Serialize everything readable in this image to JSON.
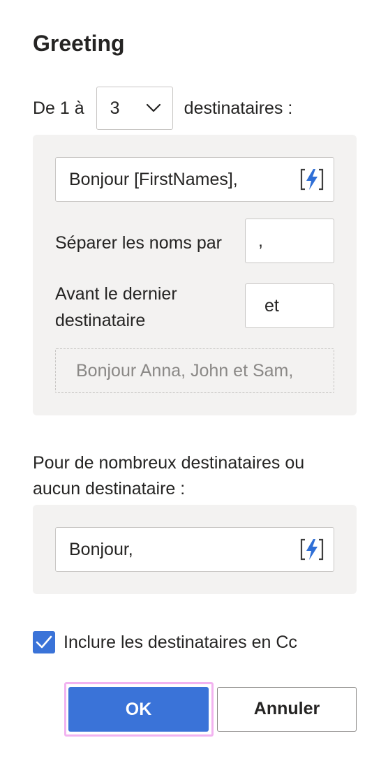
{
  "dialog": {
    "title": "Greeting"
  },
  "range": {
    "prefix": "De 1 à",
    "count_value": "3",
    "suffix": "destinataires :"
  },
  "named_panel": {
    "greeting_value": "Bonjour [FirstNames],",
    "separator_label": "Séparer les noms par",
    "separator_value": ",",
    "last_label_line1": "Avant le dernier",
    "last_label_line2": "destinataire",
    "last_value": "et",
    "preview_text": "Bonjour Anna, John et Sam,"
  },
  "fallback": {
    "label_line1": "Pour de nombreux destinataires ou",
    "label_line2": "aucun destinataire :",
    "greeting_value": "Bonjour,"
  },
  "cc": {
    "label": "Inclure les destinataires en Cc",
    "checked": true
  },
  "buttons": {
    "ok_label": "OK",
    "cancel_label": "Annuler"
  },
  "colors": {
    "accent": "#3a73d8",
    "panel_bg": "#f3f2f1",
    "focus_ring": "#f2b3f0",
    "border": "#c8c6c4",
    "placeholder_text": "#8a8886"
  },
  "icons": {
    "dropdown": "chevron-down-icon",
    "insert_field": "lightning-bolt-icon",
    "checkbox": "checkmark-icon"
  }
}
